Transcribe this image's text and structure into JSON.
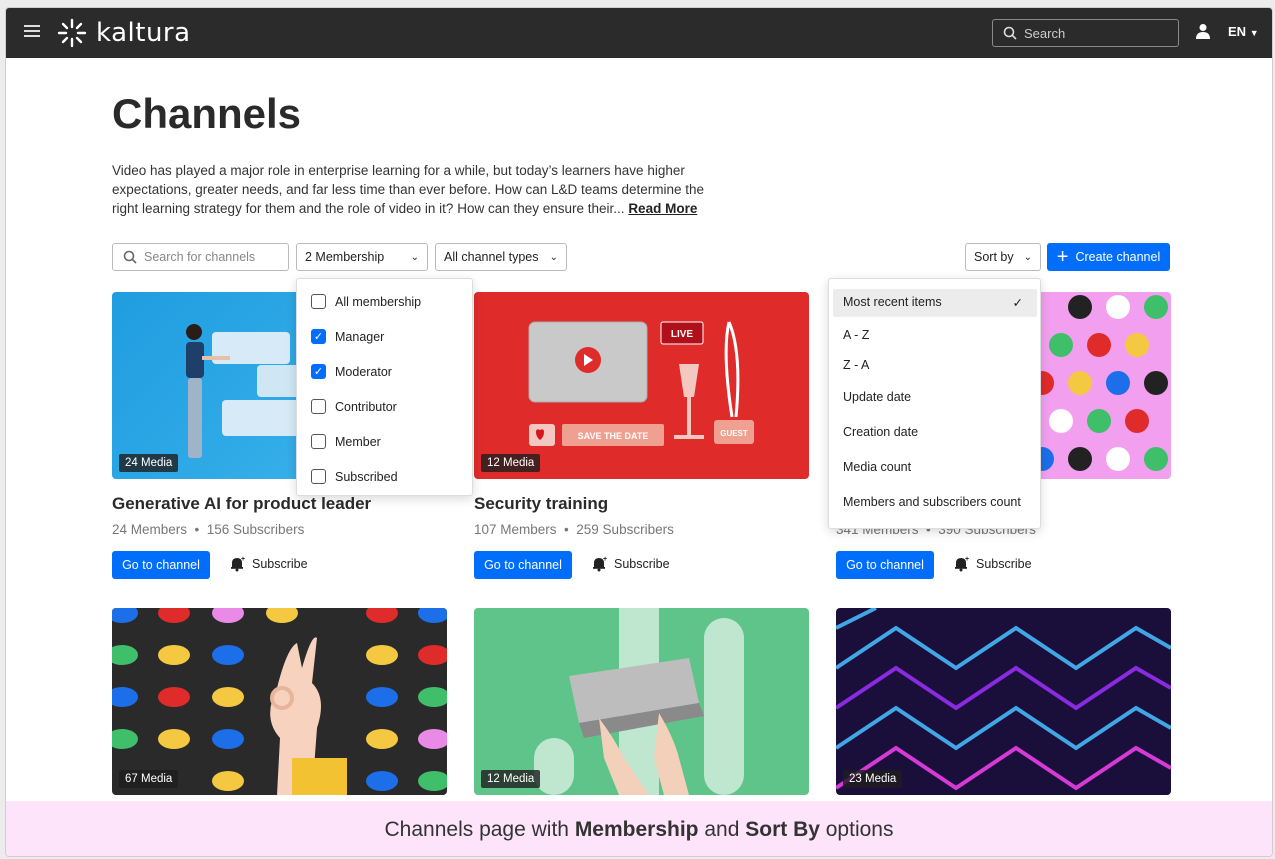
{
  "header": {
    "logo_text": "kaltura",
    "search_placeholder": "Search",
    "lang": "EN"
  },
  "page": {
    "title": "Channels",
    "description": "Video has played a major role in enterprise learning for a while, but today’s learners have higher expectations, greater needs, and far less time than ever before. How can L&D teams determine the right learning strategy for them and the role of video in it? How can they ensure their...",
    "read_more": "Read More"
  },
  "filters": {
    "search_placeholder": "Search for channels",
    "membership_label": "2 Membership",
    "channel_types_label": "All channel types",
    "sort_label": "Sort by",
    "create_label": "Create channel"
  },
  "membership_menu": {
    "items": [
      {
        "label": "All membership",
        "checked": false
      },
      {
        "label": "Manager",
        "checked": true
      },
      {
        "label": "Moderator",
        "checked": true
      },
      {
        "label": "Contributor",
        "checked": false
      },
      {
        "label": "Member",
        "checked": false
      },
      {
        "label": "Subscribed",
        "checked": false
      }
    ]
  },
  "sort_menu": {
    "selected_check": "✓",
    "items": [
      "Most recent items",
      "A - Z",
      "Z - A",
      "Update date",
      "Creation date",
      "Media count",
      "Members and subscribers count"
    ]
  },
  "cards": [
    {
      "media": "24 Media",
      "title": "Generative AI for product leader",
      "members": "24 Members",
      "subscribers": "156 Subscribers",
      "go": "Go to channel",
      "subscribe": "Subscribe"
    },
    {
      "media": "12 Media",
      "title": "Security training",
      "members": "107 Members",
      "subscribers": "259 Subscribers",
      "go": "Go to channel",
      "subscribe": "Subscribe"
    },
    {
      "media": "",
      "title": "",
      "members": "341 Members",
      "subscribers": "390 Subscribers",
      "go": "Go to channel",
      "subscribe": "Subscribe"
    },
    {
      "media": "67 Media"
    },
    {
      "media": "12 Media"
    },
    {
      "media": "23 Media"
    }
  ],
  "thumb_text": {
    "live": "LIVE",
    "save_date": "SAVE THE DATE",
    "guest": "GUEST"
  },
  "footer": {
    "prefix": "Channels page with ",
    "bold1": "Membership",
    "mid": " and ",
    "bold2": "Sort By",
    "suffix": " options"
  },
  "colors": {
    "accent": "#006efa",
    "topbar": "#2b2b2b",
    "footer_bg": "#fde4fb"
  }
}
